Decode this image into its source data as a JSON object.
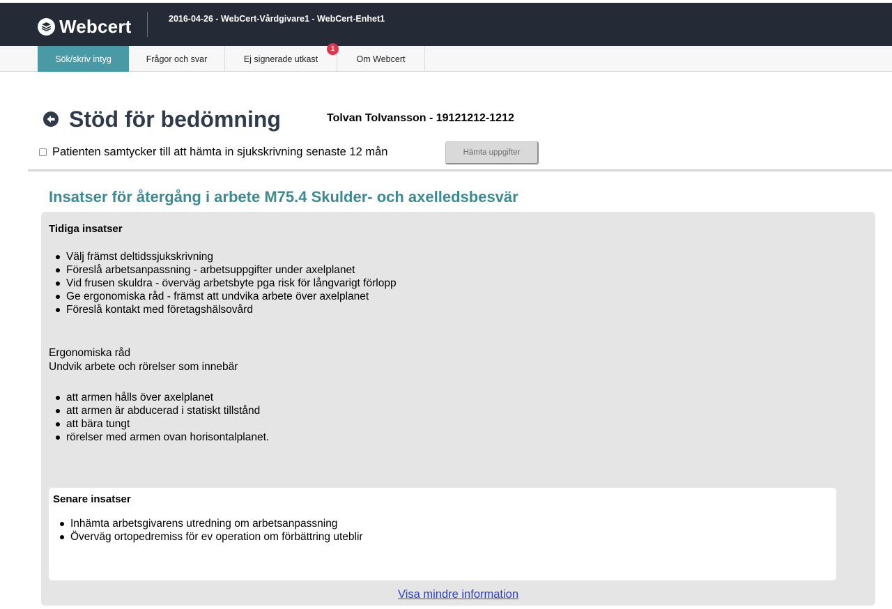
{
  "header": {
    "app_name": "Webcert",
    "context": "2016-04-26 - WebCert-Vårdgivare1 - WebCert-Enhet1"
  },
  "nav": {
    "tabs": [
      {
        "label": "Sök/skriv intyg",
        "active": true
      },
      {
        "label": "Frågor och svar",
        "active": false
      },
      {
        "label": "Ej signerade utkast",
        "active": false,
        "badge": "1"
      },
      {
        "label": "Om Webcert",
        "active": false
      }
    ]
  },
  "page": {
    "title": "Stöd för bedömning",
    "patient": "Tolvan Tolvansson - 19121212-1212",
    "consent_label": "Patienten samtycker till att hämta in sjukskrivning senaste 12 mån",
    "consent_checked": false,
    "fetch_button": "Hämta uppgifter"
  },
  "section": {
    "heading": "Insatser för återgång i arbete M75.4 Skulder- och axelledsbesvär",
    "early": {
      "title": "Tidiga insatser",
      "items": [
        "Välj främst deltidssjukskrivning",
        "Föreslå arbetsanpassning - arbetsuppgifter under axelplanet",
        "Vid frusen skuldra - överväg arbetsbyte pga risk för långvarigt förlopp",
        "Ge ergonomiska råd - främst att undvika arbete över axelplanet",
        "Föreslå kontakt med företagshälsovård"
      ],
      "ergonomic_title": "Ergonomiska råd",
      "ergonomic_intro": "Undvik arbete och rörelser som innebär",
      "ergonomic_items": [
        "att armen hålls över axelplanet",
        "att armen är abducerad i statiskt tillstånd",
        "att bära tungt",
        "rörelser med armen ovan horisontalplanet."
      ]
    },
    "late": {
      "title": "Senare insatser",
      "items": [
        "Inhämta arbetsgivarens utredning om arbetsanpassning",
        "Överväg ortopedremiss för ev operation om förbättring uteblir"
      ]
    },
    "toggle_link": "Visa mindre information"
  },
  "colors": {
    "topbar": "#252b36",
    "accent": "#4a9aa5",
    "heading": "#3d8a93",
    "badge": "#e0344b",
    "link": "#2b3fd0"
  },
  "icons": [
    "webcert-logo-icon",
    "back-arrow-icon"
  ]
}
